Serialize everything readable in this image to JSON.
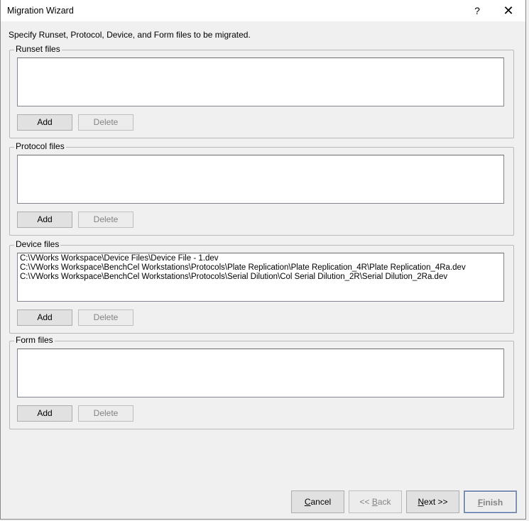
{
  "window": {
    "title": "Migration Wizard",
    "help_label": "?",
    "close_label": "✕"
  },
  "instruction": "Specify Runset, Protocol, Device, and Form files to be migrated.",
  "groups": {
    "runset": {
      "label": "Runset files",
      "items": [],
      "add_label": "Add",
      "delete_label": "Delete"
    },
    "protocol": {
      "label": "Protocol files",
      "items": [],
      "add_label": "Add",
      "delete_label": "Delete"
    },
    "device": {
      "label": "Device files",
      "items": [
        "C:\\VWorks Workspace\\Device Files\\Device File - 1.dev",
        "C:\\VWorks Workspace\\BenchCel Workstations\\Protocols\\Plate Replication\\Plate Replication_4R\\Plate Replication_4Ra.dev",
        "C:\\VWorks Workspace\\BenchCel Workstations\\Protocols\\Serial Dilution\\Col Serial Dilution_2R\\Serial Dilution_2Ra.dev"
      ],
      "add_label": "Add",
      "delete_label": "Delete"
    },
    "form": {
      "label": "Form files",
      "items": [],
      "add_label": "Add",
      "delete_label": "Delete"
    }
  },
  "footer": {
    "cancel_label": "Cancel",
    "back_label": "<< Back",
    "next_label": "Next >>",
    "finish_label": "Finish"
  }
}
